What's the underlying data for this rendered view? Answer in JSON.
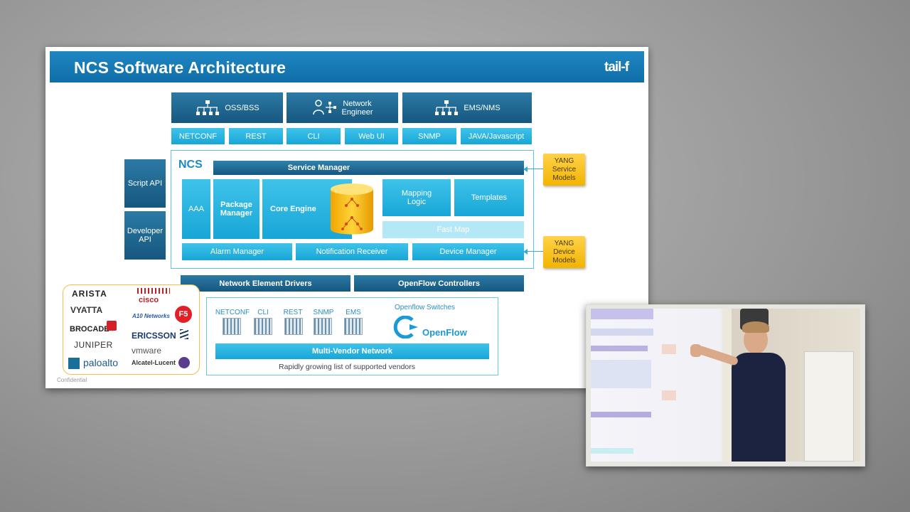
{
  "slide": {
    "title": "NCS Software Architecture",
    "logo": "tail-f",
    "footer": "Confidential"
  },
  "clients": [
    {
      "label": "OSS/BSS",
      "icon": "hierarchy-icon"
    },
    {
      "label": "Network\nEngineer",
      "icon": "user-network-icon"
    },
    {
      "label": "EMS/NMS",
      "icon": "hierarchy-icon"
    }
  ],
  "interfaces": [
    "NETCONF",
    "REST",
    "CLI",
    "Web UI",
    "SNMP",
    "JAVA/Javascript"
  ],
  "side_apis": [
    "Script API",
    "Developer\nAPI"
  ],
  "ncs": {
    "label": "NCS",
    "service_manager": "Service Manager",
    "aaa": "AAA",
    "package_manager": "Package\nManager",
    "core_engine": "Core Engine",
    "mapping_logic": "Mapping\nLogic",
    "templates": "Templates",
    "fast_map": "Fast Map",
    "alarm_manager": "Alarm Manager",
    "notification_receiver": "Notification Receiver",
    "device_manager": "Device Manager"
  },
  "yang_service": "YANG\nService\nModels",
  "yang_device": "YANG\nDevice\nModels",
  "drivers": {
    "ned": "Network Element Drivers",
    "openflow_controllers": "OpenFlow Controllers"
  },
  "vendors": [
    "ARISTA",
    "cisco",
    "VYATTA",
    "A10 Networks",
    "F5",
    "BROCADE",
    "ERICSSON",
    "JUNIPER",
    "vmware",
    "paloalto",
    "Alcatel-Lucent"
  ],
  "protocols": [
    "NETCONF",
    "CLI",
    "REST",
    "SNMP",
    "EMS"
  ],
  "openflow": {
    "switches_label": "Openflow Switches",
    "logo_text": "OpenFlow"
  },
  "multi_vendor": "Multi-Vendor Network",
  "caption": "Rapidly growing list of supported vendors",
  "colors": {
    "title_bar": "#1478b4",
    "dark_box": "#1d6592",
    "cyan_box": "#22aee0",
    "yang": "#f5bf1e"
  }
}
